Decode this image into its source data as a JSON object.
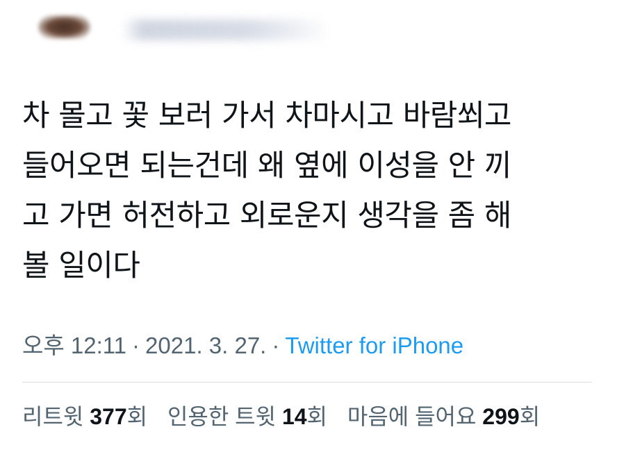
{
  "tweet": {
    "author": {
      "avatar_icon": "avatar-image-blurred",
      "handle": "@..."
    },
    "text_lines": [
      "차 몰고 꽃 보러 가서 차마시고 바람쐬고",
      "들어오면 되는건데 왜 옆에 이성을 안 끼",
      "고 가면 허전하고 외로운지 생각을 좀 해",
      "볼 일이다"
    ],
    "time": "오후 12:11",
    "date": "2021. 3. 27.",
    "separator": "·",
    "source": "Twitter for iPhone",
    "stats": {
      "retweets": {
        "label": "리트윗",
        "count": "377",
        "suffix": "회"
      },
      "quotes": {
        "label": "인용한 트윗",
        "count": "14",
        "suffix": "회"
      },
      "likes": {
        "label": "마음에 들어요",
        "count": "299",
        "suffix": "회"
      }
    }
  },
  "colors": {
    "text": "#0f1419",
    "secondary": "#536471",
    "link": "#1d9bf0",
    "divider": "#dcdfe3"
  }
}
